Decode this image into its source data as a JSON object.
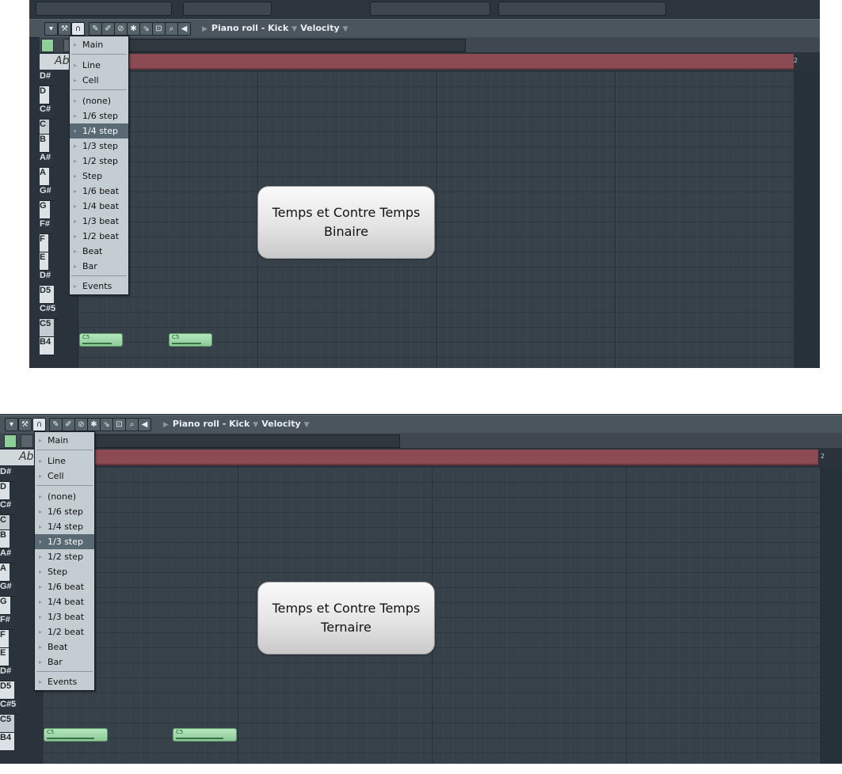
{
  "panels": [
    {
      "header": {
        "title": "Piano roll - Kick",
        "velocity": "Velocity"
      },
      "keys": [
        "D#",
        "D",
        "C#",
        "C",
        "B",
        "A#",
        "A",
        "G#",
        "G",
        "F#",
        "F",
        "E",
        "D#",
        "D5",
        "C#5",
        "C5",
        "B4"
      ],
      "note_label": "C5",
      "snap_menu": {
        "items": [
          "Main",
          "Line",
          "Cell",
          "(none)",
          "1/6 step",
          "1/4 step",
          "1/3 step",
          "1/2 step",
          "Step",
          "1/6 beat",
          "1/4 beat",
          "1/3 beat",
          "1/2 beat",
          "Beat",
          "Bar",
          "Events"
        ],
        "selected": "1/4 step"
      },
      "callout": {
        "line1": "Temps et Contre Temps",
        "line2": "Binaire"
      },
      "timeline_marker": "2",
      "header_label": "Ab"
    },
    {
      "header": {
        "title": "Piano roll - Kick",
        "velocity": "Velocity"
      },
      "keys": [
        "D#",
        "D",
        "C#",
        "C",
        "B",
        "A#",
        "A",
        "G#",
        "G",
        "F#",
        "F",
        "E",
        "D#",
        "D5",
        "C#5",
        "C5",
        "B4"
      ],
      "note_label": "C5",
      "snap_menu": {
        "items": [
          "Main",
          "Line",
          "Cell",
          "(none)",
          "1/6 step",
          "1/4 step",
          "1/3 step",
          "1/2 step",
          "Step",
          "1/6 beat",
          "1/4 beat",
          "1/3 beat",
          "1/2 beat",
          "Beat",
          "Bar",
          "Events"
        ],
        "selected": "1/3 step"
      },
      "callout": {
        "line1": "Temps et Contre Temps",
        "line2": "Ternaire"
      },
      "timeline_marker": "2",
      "header_label": "Ab"
    }
  ],
  "colors": {
    "note_fill": "#9fd8a9",
    "timeline": "#8c4a52",
    "grid": "#37414a",
    "menu_bg": "#c4cdd2",
    "menu_selected": "#5a6a74"
  }
}
